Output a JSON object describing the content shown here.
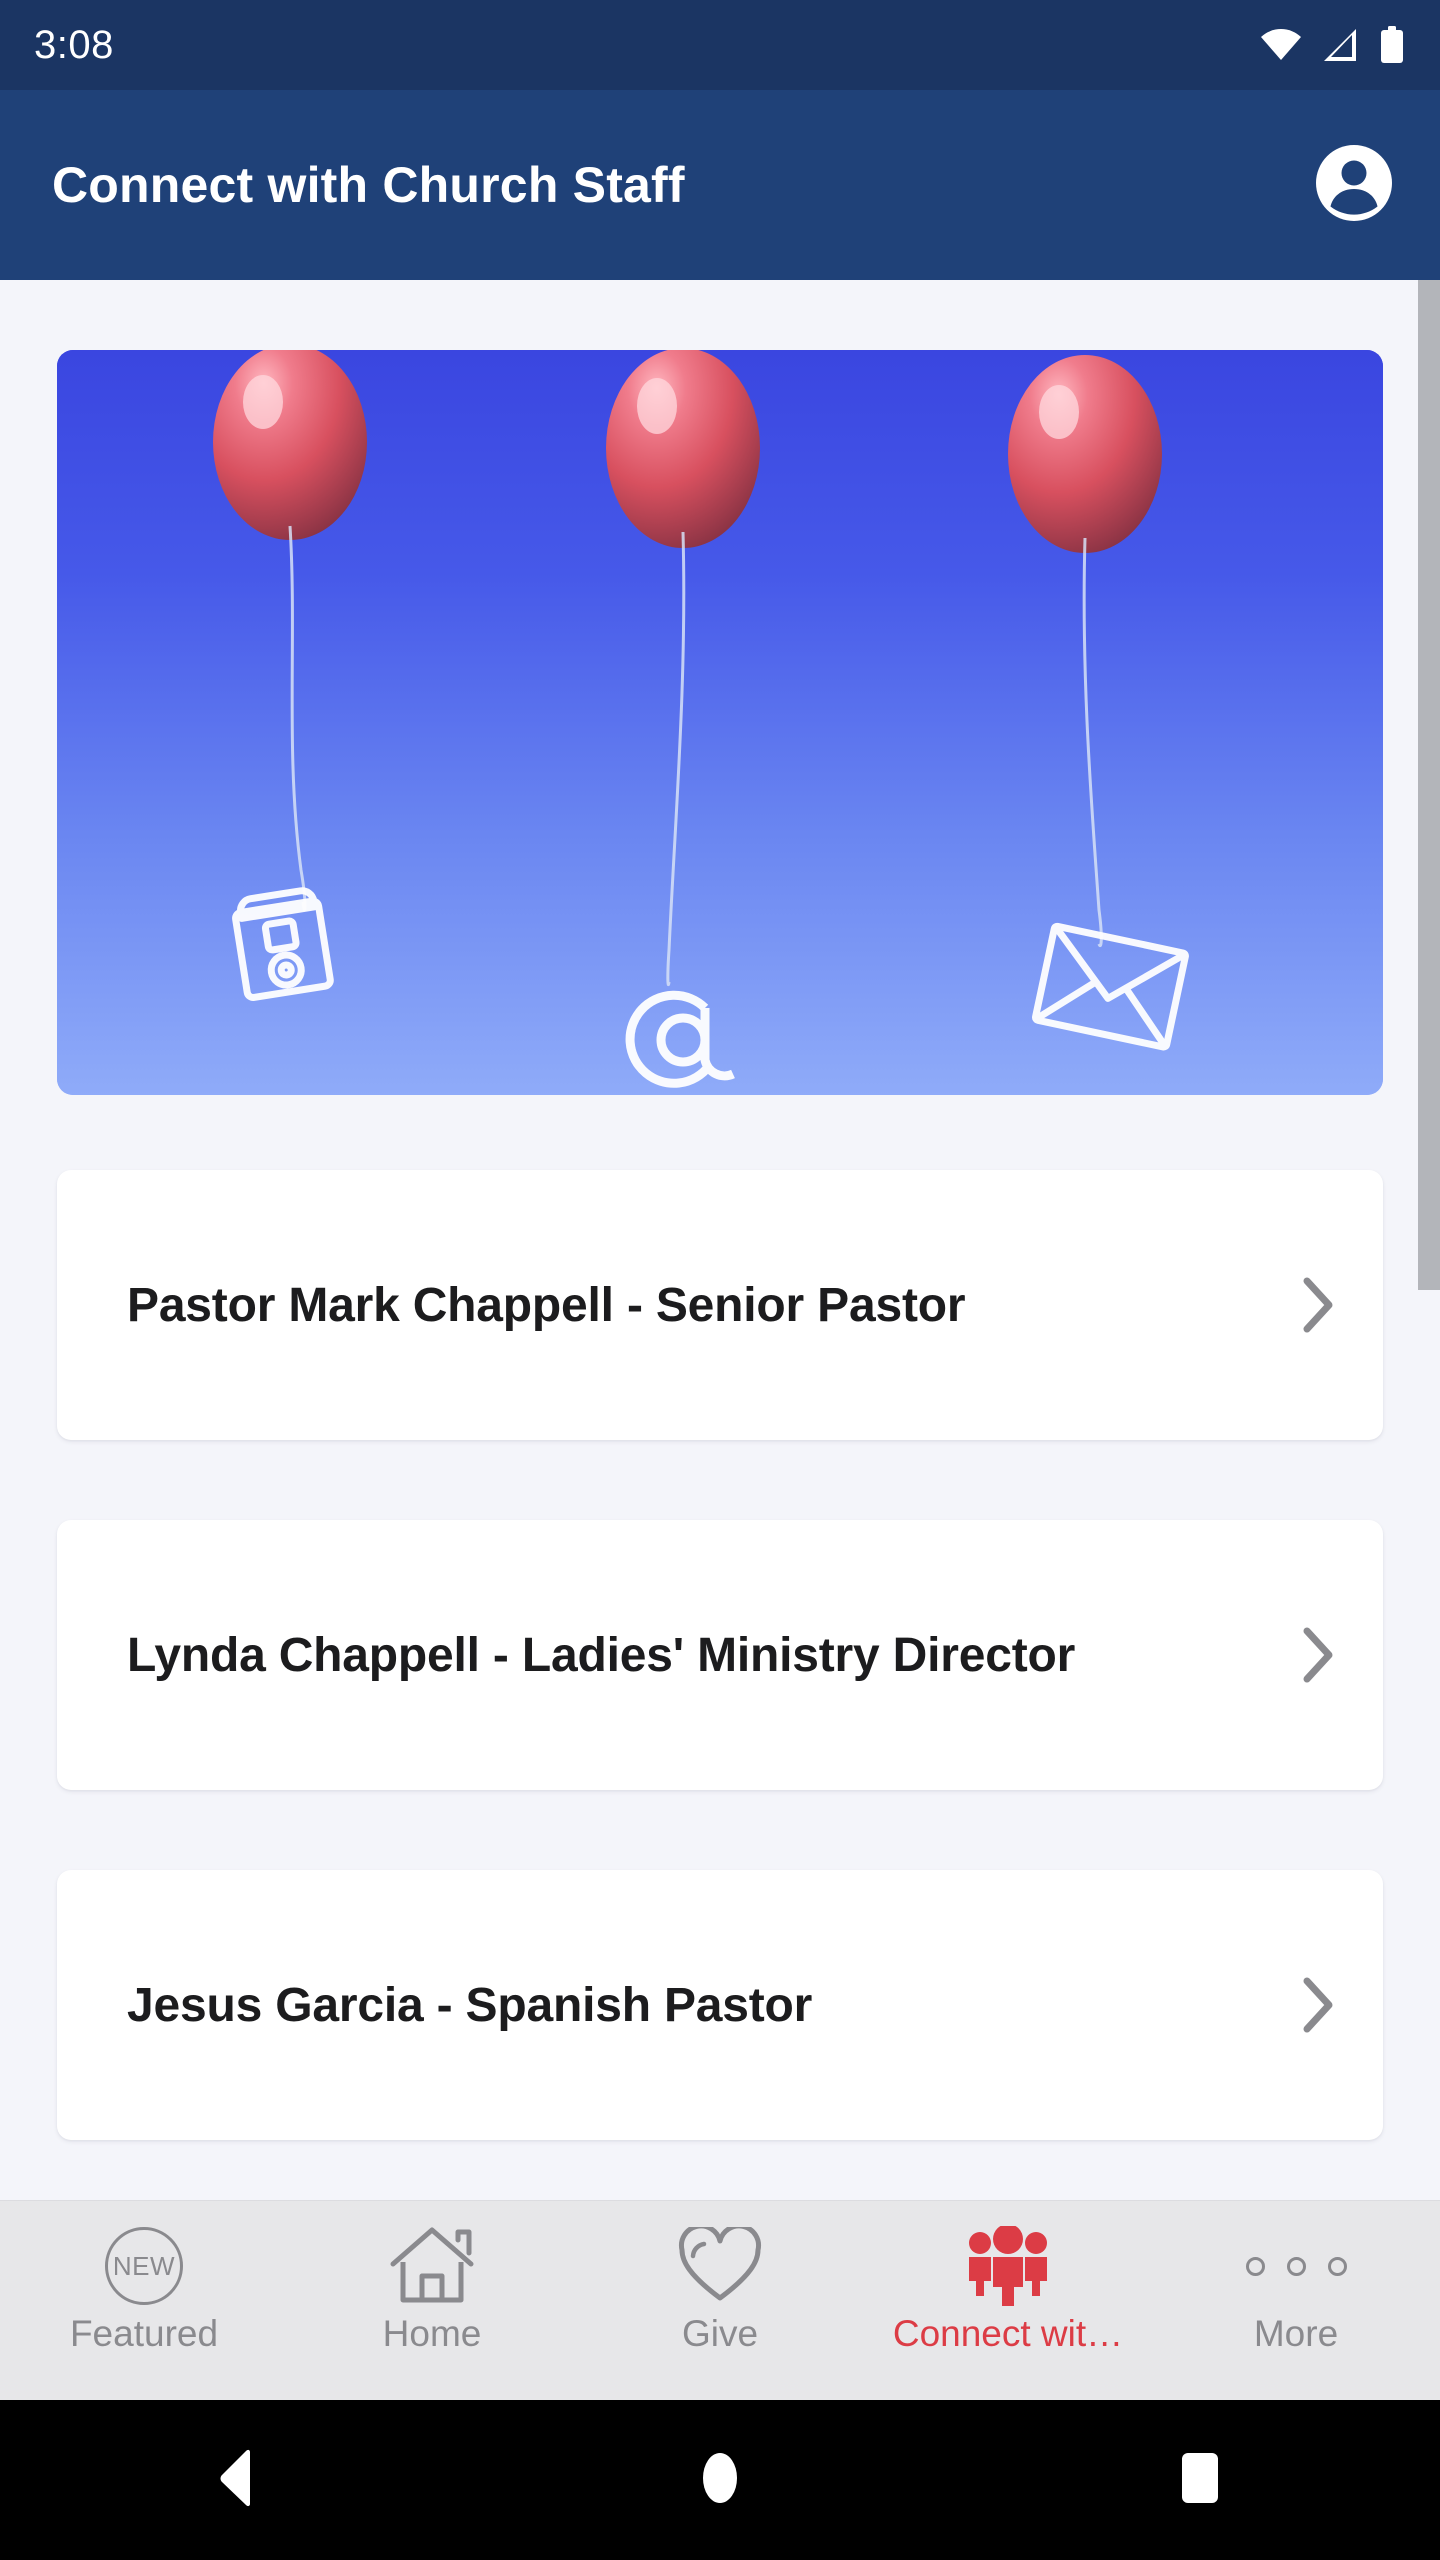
{
  "status_bar": {
    "time": "3:08",
    "icons": [
      "wifi-icon",
      "cellular-signal-icon",
      "battery-icon"
    ]
  },
  "app_bar": {
    "title": "Connect with Church Staff",
    "account_icon": "account-circle-icon"
  },
  "hero": {
    "alt": "Three red balloons on strings tied to telephone, at-sign and envelope symbols against a blue sky",
    "icons": [
      "telephone-icon",
      "at-sign-icon",
      "envelope-icon"
    ],
    "balloon_count": 3
  },
  "staff_list": [
    {
      "label": "Pastor Mark Chappell - Senior Pastor",
      "chevron": "chevron-right-icon"
    },
    {
      "label": "Lynda Chappell - Ladies' Ministry Director",
      "chevron": "chevron-right-icon"
    },
    {
      "label": "Jesus Garcia - Spanish Pastor",
      "chevron": "chevron-right-icon"
    }
  ],
  "tab_bar": {
    "active_index": 3,
    "active_color": "#dc3c45",
    "inactive_color": "#8a8a8e",
    "items": [
      {
        "label": "Featured",
        "icon": "new-badge-icon",
        "badge_text": "NEW"
      },
      {
        "label": "Home",
        "icon": "home-icon"
      },
      {
        "label": "Give",
        "icon": "heart-icon"
      },
      {
        "label": "Connect wit…",
        "icon": "people-group-icon"
      },
      {
        "label": "More",
        "icon": "three-dots-icon"
      }
    ]
  },
  "android_nav": {
    "back": "back-triangle-icon",
    "home": "home-circle-icon",
    "recents": "recents-square-icon"
  },
  "colors": {
    "status_bar_bg": "#1b3563",
    "app_bar_bg": "#1f4178",
    "content_bg": "#f4f5fa",
    "card_bg": "#ffffff",
    "accent": "#dc3c45",
    "tab_bar_bg": "#e7e7e9"
  }
}
